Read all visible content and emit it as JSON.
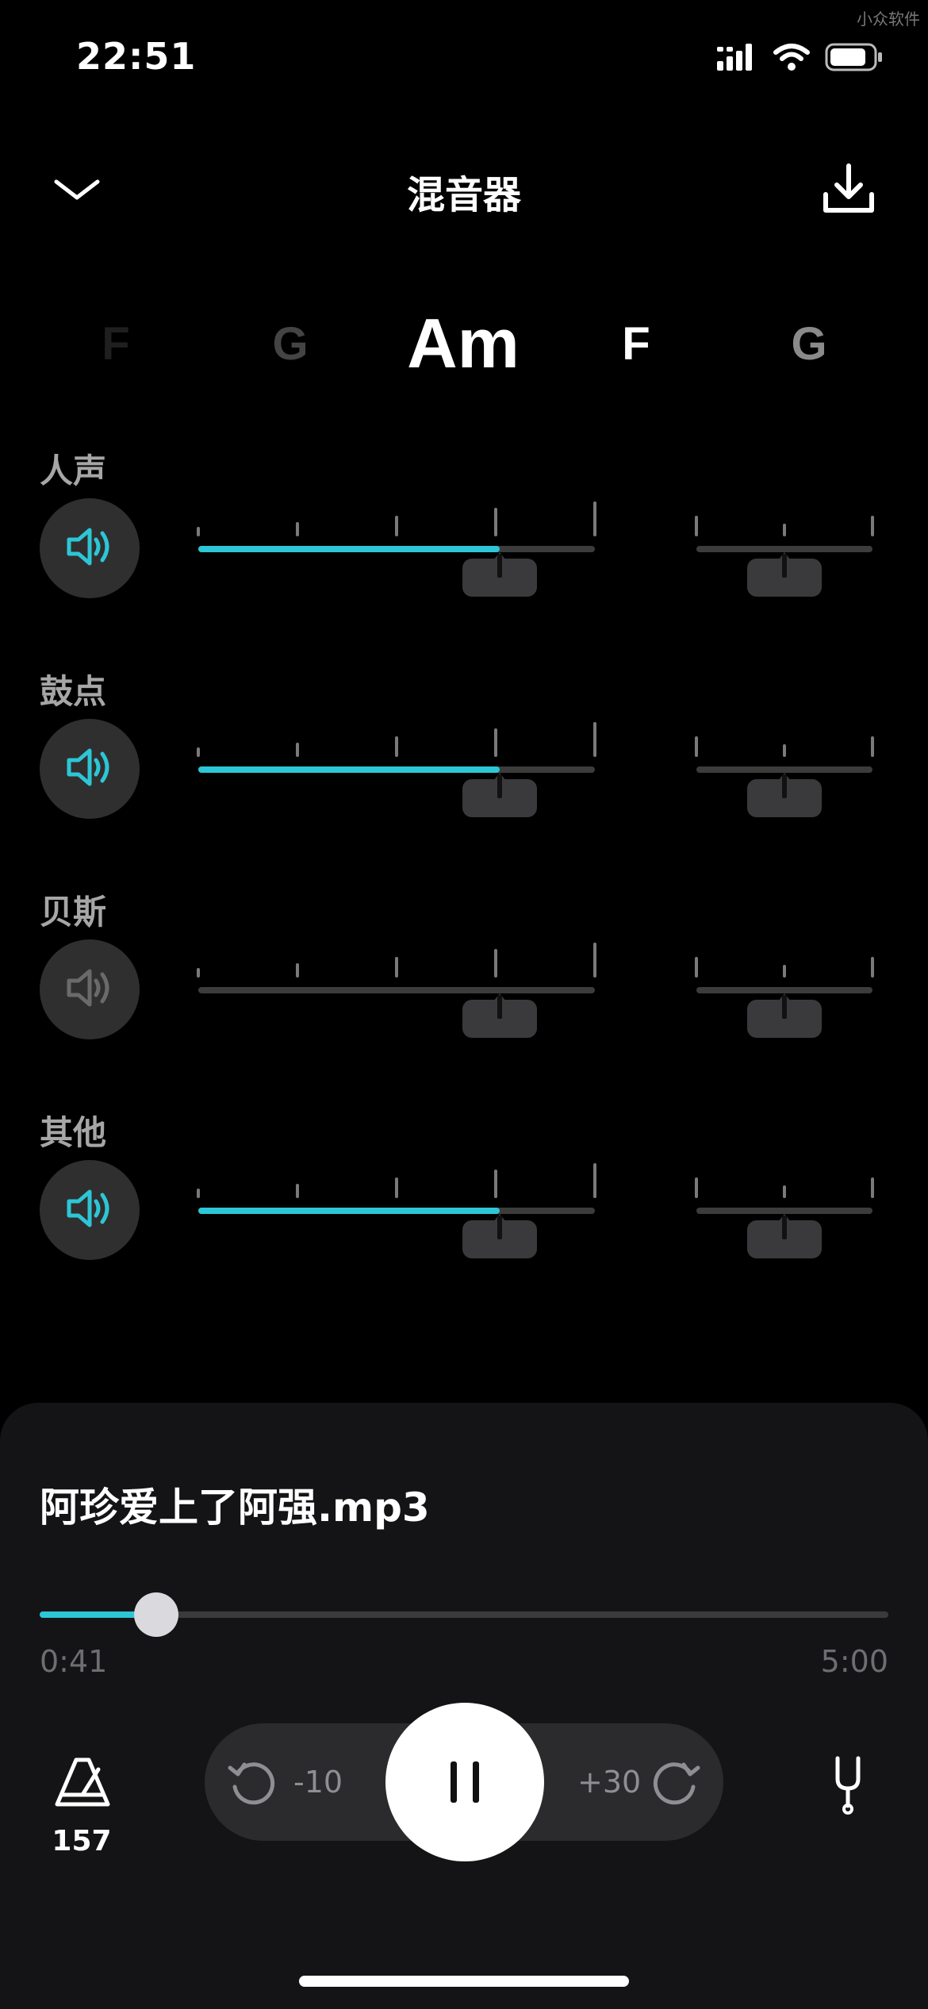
{
  "status_bar": {
    "time": "22:51",
    "watermark": "小众软件"
  },
  "header": {
    "title": "混音器",
    "collapse_icon": "chevron-down-icon",
    "download_icon": "download-icon"
  },
  "chords": [
    {
      "label": "F"
    },
    {
      "label": "G"
    },
    {
      "label": "Am",
      "current": true
    },
    {
      "label": "F"
    },
    {
      "label": "G"
    }
  ],
  "tracks": [
    {
      "label": "人声",
      "muted": false,
      "volume": 0.76,
      "pan": 0.5
    },
    {
      "label": "鼓点",
      "muted": false,
      "volume": 0.76,
      "pan": 0.5
    },
    {
      "label": "贝斯",
      "muted": true,
      "volume": 0.0,
      "pan": 0.5
    },
    {
      "label": "其他",
      "muted": false,
      "volume": 0.76,
      "pan": 0.5
    }
  ],
  "player": {
    "song_title": "阿珍爱上了阿强.mp3",
    "current_time": "0:41",
    "total_time": "5:00",
    "progress": 0.137,
    "rewind_label": "-10",
    "forward_label": "+30",
    "bpm": "157",
    "state": "playing"
  },
  "colors": {
    "accent": "#2cc6d6",
    "muted_icon": "#6a6a6a",
    "background": "#000000"
  }
}
